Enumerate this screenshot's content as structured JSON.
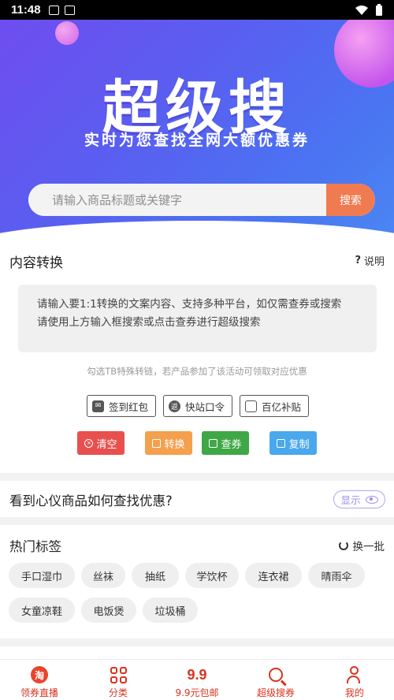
{
  "status_bar": {
    "time": "11:48"
  },
  "hero": {
    "title": "超级搜",
    "subtitle": "实时为您查找全网大额优惠券",
    "search_placeholder": "请输入商品标题或关键字",
    "search_button": "搜索"
  },
  "convert": {
    "title": "内容转换",
    "help_label": "说明",
    "box_text": "请输入要1:1转换的文案内容、支持多种平台，如仅需查券或搜索\n请使用上方输入框搜索或点击查券进行超级搜索",
    "hint": "勾选TB特殊转链，若产品参加了该活动可领取对应优惠",
    "options": [
      {
        "label": "签到红包",
        "icon": "red-envelope-icon"
      },
      {
        "label": "快站口令",
        "icon": "fast-station-icon"
      },
      {
        "label": "百亿补贴",
        "icon": "subsidy-icon"
      }
    ],
    "actions": [
      {
        "label": "清空",
        "color": "#e8504f"
      },
      {
        "label": "转换",
        "color": "#f4a04e"
      },
      {
        "label": "查券",
        "color": "#3fa846"
      },
      {
        "label": "复制",
        "color": "#4aa8ec"
      }
    ]
  },
  "finder": {
    "title": "看到心仪商品如何查找优惠?",
    "show_label": "显示"
  },
  "hot_tags": {
    "title": "热门标签",
    "refresh_label": "换一批",
    "tags": [
      "手口湿巾",
      "丝袜",
      "抽纸",
      "学饮杯",
      "连衣裙",
      "晴雨伞",
      "女童凉鞋",
      "电饭煲",
      "垃圾桶"
    ]
  },
  "bottom_nav": {
    "items": [
      {
        "label": "领券直播",
        "icon": "taobao-icon",
        "glyph": "淘"
      },
      {
        "label": "分类",
        "icon": "category-icon"
      },
      {
        "label": "9.9元包邮",
        "icon": "nine-nine-icon",
        "glyph": "9.9"
      },
      {
        "label": "超级搜券",
        "icon": "search-icon"
      },
      {
        "label": "我的",
        "icon": "profile-icon"
      }
    ],
    "active_color": "#d9331f"
  }
}
